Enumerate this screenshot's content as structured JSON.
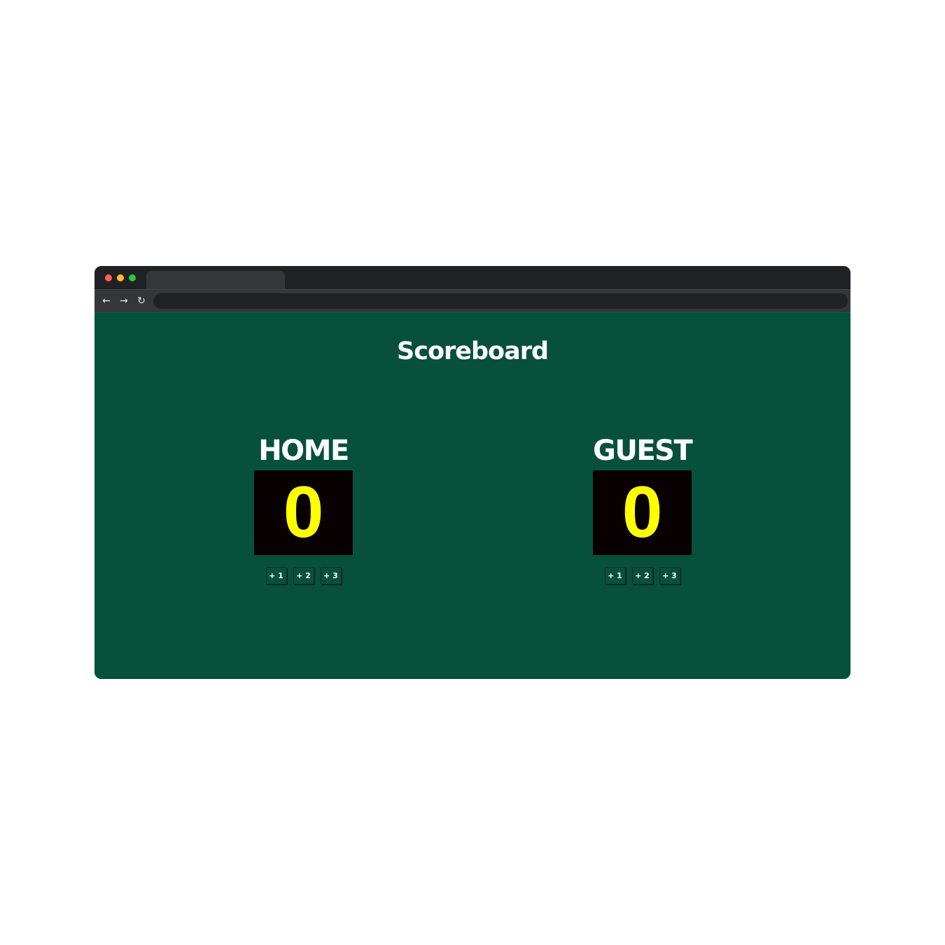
{
  "page": {
    "title": "Scoreboard"
  },
  "teams": [
    {
      "name": "HOME",
      "score": "0",
      "buttons": [
        "+ 1",
        "+ 2",
        "+ 3"
      ]
    },
    {
      "name": "GUEST",
      "score": "0",
      "buttons": [
        "+ 1",
        "+ 2",
        "+ 3"
      ]
    }
  ],
  "browser": {
    "nav_icons": [
      "arrow-left-icon",
      "arrow-right-icon",
      "reload-icon"
    ]
  },
  "colors": {
    "background": "#07503c",
    "score_box": "#080001",
    "score_text": "#ffff00",
    "text": "#ffffff"
  }
}
